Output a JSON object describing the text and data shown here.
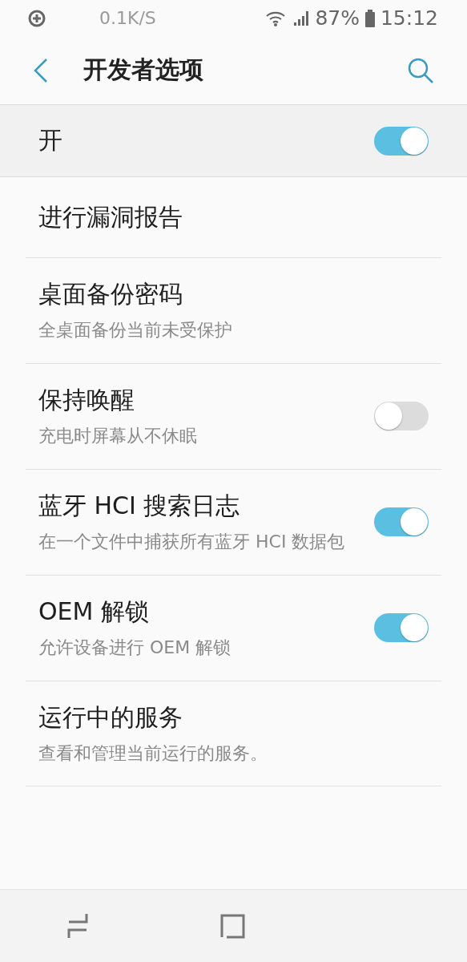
{
  "status_bar": {
    "speed": "0.1K/S",
    "battery": "87%",
    "time": "15:12"
  },
  "header": {
    "title": "开发者选项"
  },
  "master_switch": {
    "label": "开",
    "on": true
  },
  "items": [
    {
      "kind": "plain",
      "title": "进行漏洞报告"
    },
    {
      "kind": "plain",
      "title": "桌面备份密码",
      "subtitle": "全桌面备份当前未受保护"
    },
    {
      "kind": "toggle",
      "title": "保持唤醒",
      "subtitle": "充电时屏幕从不休眠",
      "on": false
    },
    {
      "kind": "toggle",
      "title": "蓝牙 HCI 搜索日志",
      "subtitle": "在一个文件中捕获所有蓝牙 HCI 数据包",
      "on": true
    },
    {
      "kind": "toggle",
      "title": "OEM 解锁",
      "subtitle": "允许设备进行 OEM 解锁",
      "on": true
    },
    {
      "kind": "plain",
      "title": "运行中的服务",
      "subtitle": "查看和管理当前运行的服务。"
    }
  ]
}
